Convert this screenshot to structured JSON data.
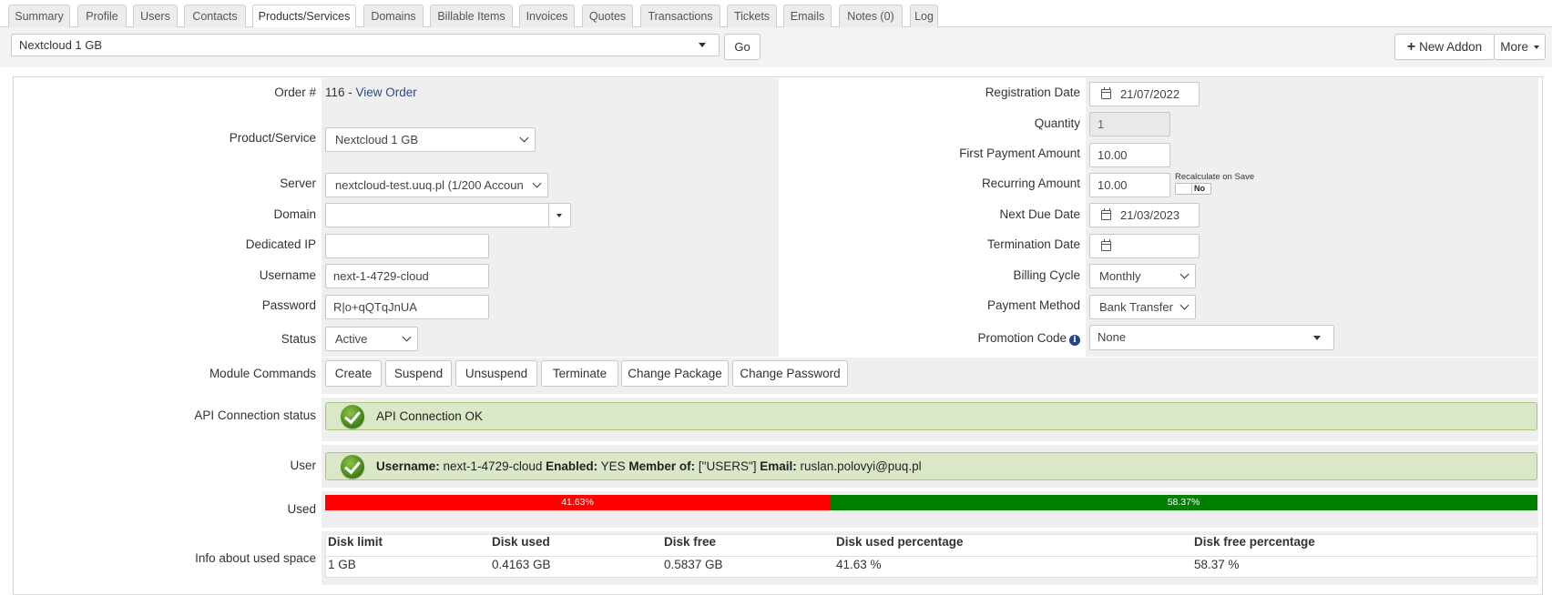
{
  "tabs": [
    "Summary",
    "Profile",
    "Users",
    "Contacts",
    "Products/Services",
    "Domains",
    "Billable Items",
    "Invoices",
    "Quotes",
    "Transactions",
    "Tickets",
    "Emails",
    "Notes (0)",
    "Log"
  ],
  "active_tab": "Products/Services",
  "topbar": {
    "product_select": "Nextcloud 1 GB",
    "go_label": "Go",
    "new_addon_label": "New Addon",
    "more_label": "More"
  },
  "left": {
    "order_label": "Order #",
    "order_number": "116 - ",
    "view_order_link": "View Order",
    "product_label": "Product/Service",
    "product_value": "Nextcloud 1 GB",
    "server_label": "Server",
    "server_value": "nextcloud-test.uuq.pl (1/200 Accoun",
    "domain_label": "Domain",
    "domain_value": "",
    "dedicated_ip_label": "Dedicated IP",
    "dedicated_ip_value": "",
    "username_label": "Username",
    "username_value": "next-1-4729-cloud",
    "password_label": "Password",
    "password_value": "R|o+qQTqJnUA",
    "status_label": "Status",
    "status_value": "Active"
  },
  "right": {
    "registration_date_label": "Registration Date",
    "registration_date_value": "21/07/2022",
    "quantity_label": "Quantity",
    "quantity_value": "1",
    "first_payment_label": "First Payment Amount",
    "first_payment_value": "10.00",
    "recurring_label": "Recurring Amount",
    "recurring_value": "10.00",
    "recalculate_label": "Recalculate on Save",
    "recalculate_toggle": "No",
    "next_due_label": "Next Due Date",
    "next_due_value": "21/03/2023",
    "termination_label": "Termination Date",
    "termination_value": "",
    "billing_cycle_label": "Billing Cycle",
    "billing_cycle_value": "Monthly",
    "payment_method_label": "Payment Method",
    "payment_method_value": "Bank Transfer",
    "promo_label": "Promotion Code",
    "promo_value": "None"
  },
  "module": {
    "label": "Module Commands",
    "commands": [
      "Create",
      "Suspend",
      "Unsuspend",
      "Terminate",
      "Change Package",
      "Change Password"
    ]
  },
  "api": {
    "label": "API Connection status",
    "text": "API Connection OK"
  },
  "user": {
    "label": "User",
    "username_key": "Username:",
    "username_val": " next-1-4729-cloud ",
    "enabled_key": "Enabled:",
    "enabled_val": " YES ",
    "member_key": "Member of:",
    "member_val": " [\"USERS\"] ",
    "email_key": "Email:",
    "email_val": " ruslan.polovyi@puq.pl"
  },
  "used": {
    "label": "Used",
    "used_percent": 41.63,
    "free_percent": 58.37,
    "used_text": "41.63%",
    "free_text": "58.37%",
    "used_color": "#ff0000",
    "free_color": "#008000"
  },
  "info": {
    "label": "Info about used space",
    "headers": [
      "Disk limit",
      "Disk used",
      "Disk free",
      "Disk used percentage",
      "Disk free percentage"
    ],
    "row": [
      "1 GB",
      "0.4163 GB",
      "0.5837 GB",
      "41.63 %",
      "58.37 %"
    ]
  },
  "colors": {
    "ok_background": "#dbe8c8",
    "ok_border": "#a9c77e",
    "link": "#2c4a8a"
  }
}
